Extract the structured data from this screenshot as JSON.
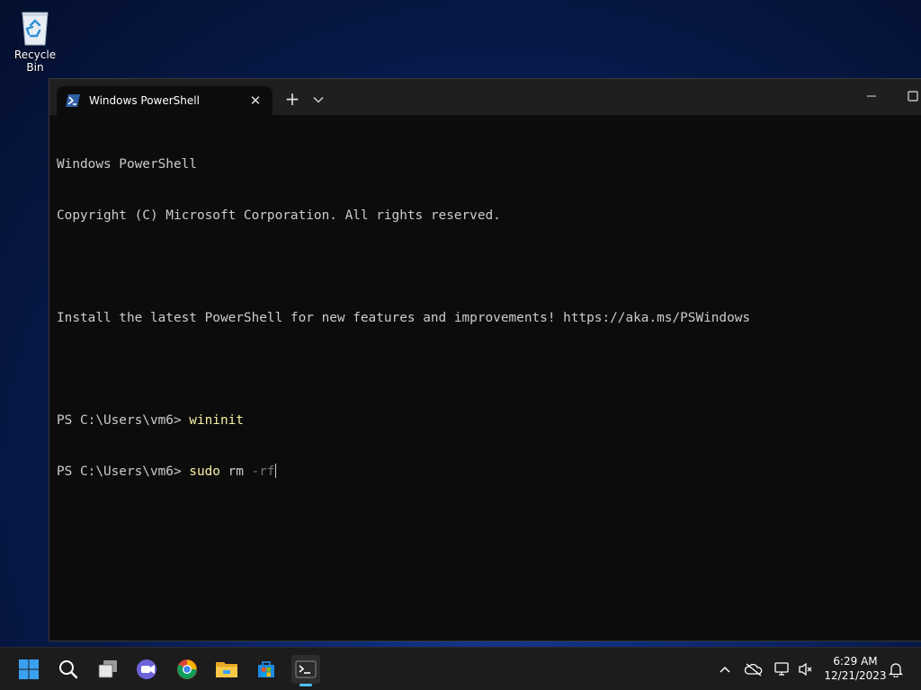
{
  "desktop": {
    "icons": [
      {
        "label": "Recycle Bin",
        "icon": "recycle-bin-icon"
      }
    ]
  },
  "window": {
    "tab_title": "Windows PowerShell",
    "new_tab_symbol": "+",
    "close_symbol": "✕"
  },
  "terminal": {
    "line1": "Windows PowerShell",
    "line2": "Copyright (C) Microsoft Corporation. All rights reserved.",
    "line3": "",
    "line4": "Install the latest PowerShell for new features and improvements! https://aka.ms/PSWindows",
    "line5": "",
    "prompt1": "PS C:\\Users\\vm6> ",
    "cmd1": "wininit",
    "prompt2": "PS C:\\Users\\vm6> ",
    "cmd2": "sudo",
    "cmd2_rest": " rm ",
    "cmd2_arg": "-rf"
  },
  "colors": {
    "terminal_bg": "#0c0c0c",
    "command": "#f9f1a5",
    "argument": "#767676",
    "text": "#cccccc",
    "accent": "#4cc2ff"
  },
  "taskbar": {
    "apps": [
      "start-icon",
      "search-icon",
      "task-view-icon",
      "chat-icon",
      "chrome-icon",
      "file-explorer-icon",
      "microsoft-store-icon",
      "terminal-icon"
    ],
    "tray": [
      "show-hidden-icons-chevron",
      "onedrive-icon",
      "network-icon",
      "volume-icon",
      "notification-bell-icon"
    ],
    "time": "6:29 AM",
    "date": "12/21/2023"
  }
}
